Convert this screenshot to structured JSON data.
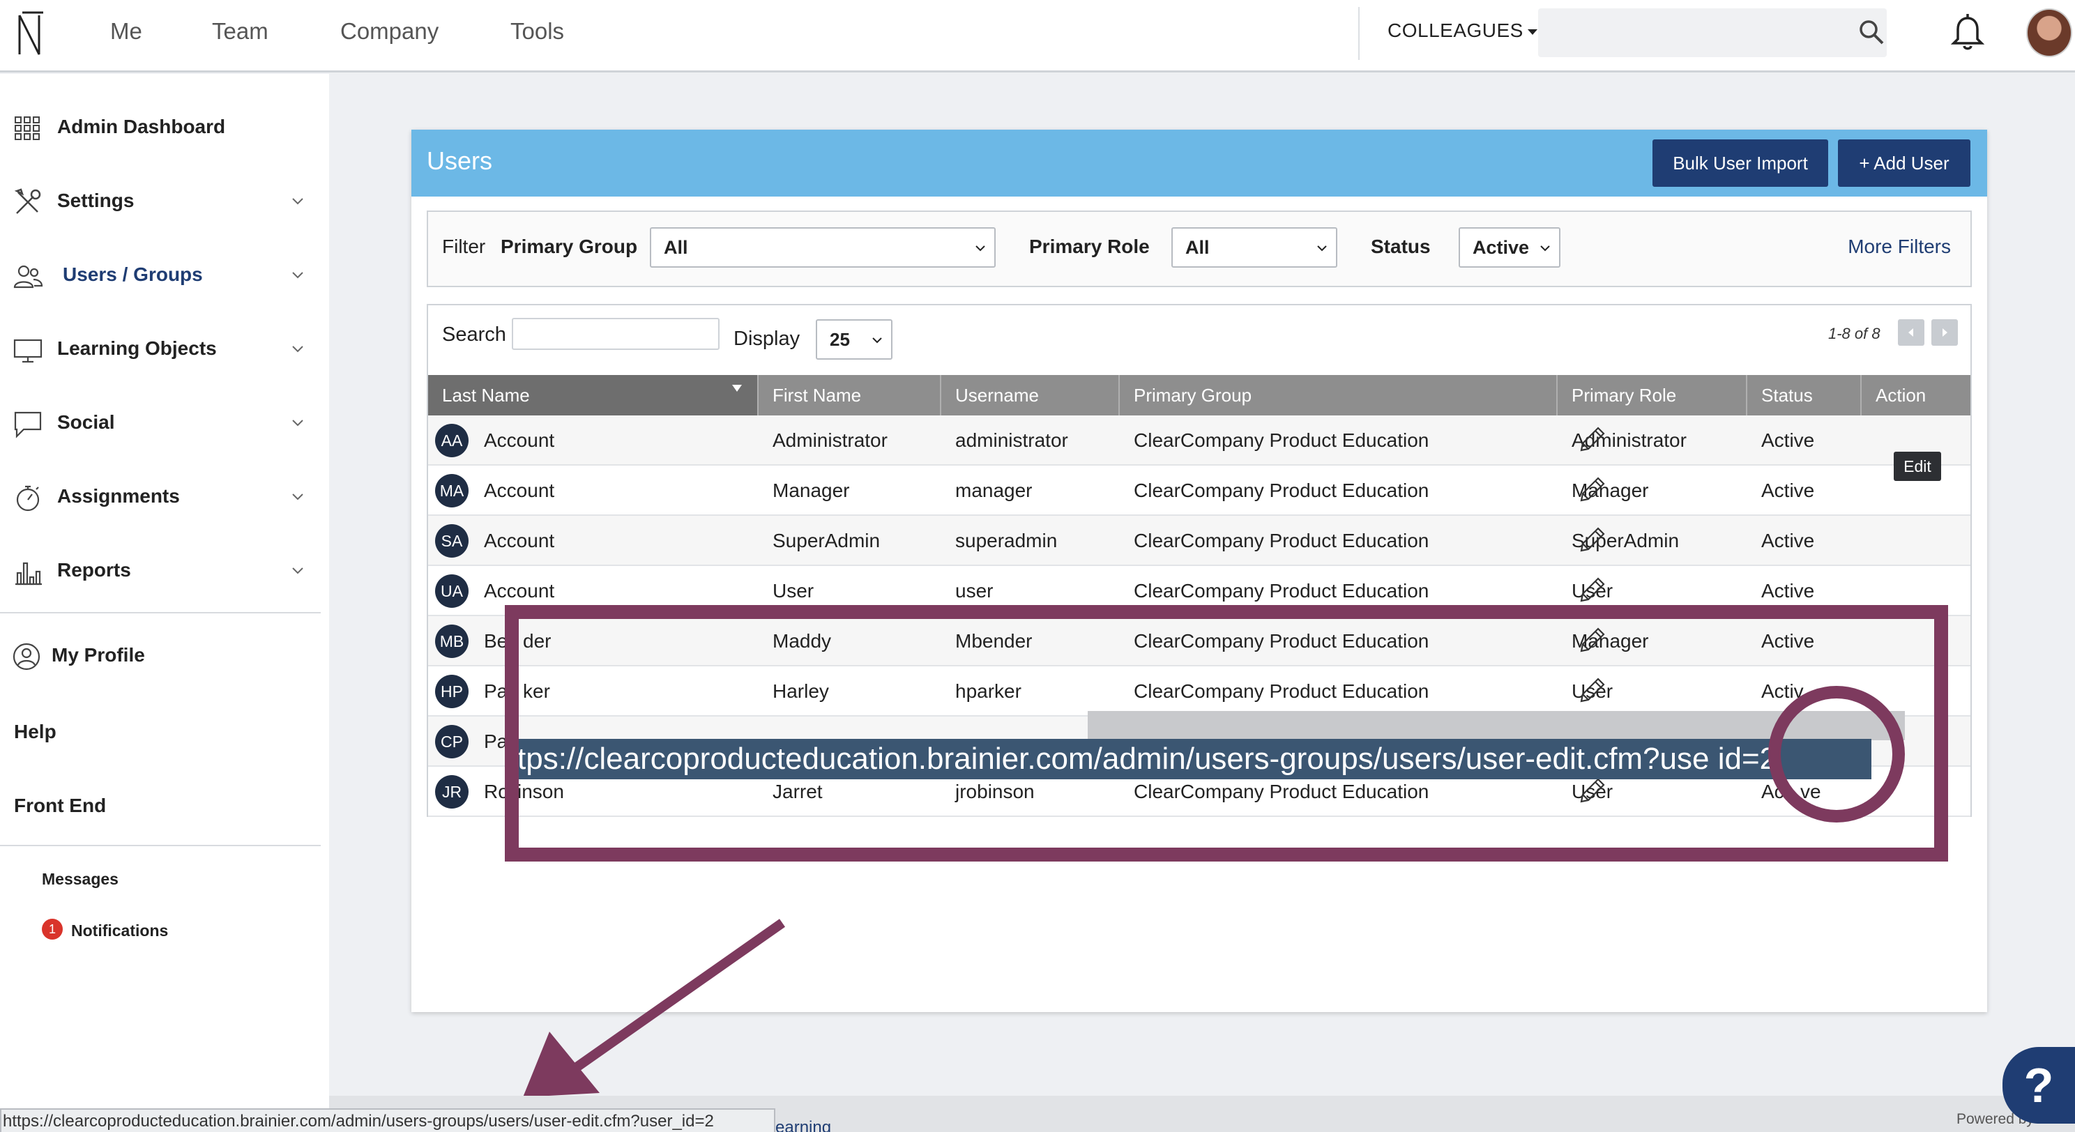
{
  "topnav": {
    "links": [
      "Me",
      "Team",
      "Company",
      "Tools"
    ],
    "colleagues_label": "COLLEAGUES",
    "search_placeholder": ""
  },
  "sidebar": {
    "items": [
      {
        "label": "Admin Dashboard",
        "icon": "grid-icon"
      },
      {
        "label": "Settings",
        "icon": "tools-icon"
      },
      {
        "label": "Users / Groups",
        "icon": "users-icon"
      },
      {
        "label": "Learning Objects",
        "icon": "monitor-icon"
      },
      {
        "label": "Social",
        "icon": "chat-icon"
      },
      {
        "label": "Assignments",
        "icon": "stopwatch-icon"
      },
      {
        "label": "Reports",
        "icon": "bar-chart-icon"
      }
    ],
    "my_profile": "My Profile",
    "help": "Help",
    "front_end": "Front End",
    "messages": "Messages",
    "notifications": "Notifications",
    "notifications_count": "1"
  },
  "card": {
    "title": "Users",
    "bulk_import": "Bulk User Import",
    "add_user": "+ Add User"
  },
  "filters": {
    "filter_label": "Filter",
    "primary_group_label": "Primary Group",
    "primary_group_value": "All",
    "primary_role_label": "Primary Role",
    "primary_role_value": "All",
    "status_label": "Status",
    "status_value": "Active",
    "more_filters": "More Filters"
  },
  "table": {
    "search_label": "Search",
    "display_label": "Display",
    "display_value": "25",
    "pager": "1-8 of 8",
    "columns": [
      "Last Name",
      "First Name",
      "Username",
      "Primary Group",
      "Primary Role",
      "Status",
      "Action"
    ],
    "rows": [
      {
        "initials": "AA",
        "last": "Account",
        "first": "Administrator",
        "username": "administrator",
        "group": "ClearCompany Product Education",
        "role": "Administrator",
        "status": "Active"
      },
      {
        "initials": "MA",
        "last": "Account",
        "first": "Manager",
        "username": "manager",
        "group": "ClearCompany Product Education",
        "role": "Manager",
        "status": "Active"
      },
      {
        "initials": "SA",
        "last": "Account",
        "first": "SuperAdmin",
        "username": "superadmin",
        "group": "ClearCompany Product Education",
        "role": "SuperAdmin",
        "status": "Active"
      },
      {
        "initials": "UA",
        "last": "Account",
        "first": "User",
        "username": "user",
        "group": "ClearCompany Product Education",
        "role": "User",
        "status": "Active"
      },
      {
        "initials": "MB",
        "last": "Be",
        "last_tail": "der",
        "first": "Maddy",
        "username": "Mbender",
        "group": "ClearCompany Product Education",
        "role": "Manager",
        "status": "Active"
      },
      {
        "initials": "HP",
        "last": "Pa",
        "last_tail": "ker",
        "first": "Harley",
        "username": "hparker",
        "group": "ClearCompany Product Education",
        "role": "User",
        "status": "Activ"
      },
      {
        "initials": "CP",
        "last": "Pa",
        "first": "",
        "username": "",
        "group": "",
        "role": "",
        "status": ""
      },
      {
        "initials": "JR",
        "last": "Ro",
        "last_tail": "inson",
        "first": "Jarret",
        "username": "jrobinson",
        "group": "ClearCompany Product Education",
        "role": "User",
        "status": "Ac",
        "status_tail": "ve"
      }
    ],
    "edit_tooltip": "Edit"
  },
  "annotation": {
    "url_zoom": "tps://clearcoproducteducation.brainier.com/admin/users-groups/users/user-edit.cfm?use   id=2",
    "color": "#7d3a5e"
  },
  "status_bar": {
    "url": "https://clearcoproducteducation.brainier.com/admin/users-groups/users/user-edit.cfm?user_id=2"
  },
  "footer": {
    "link_text": "earning",
    "powered": "Powered by"
  },
  "help_button": "?"
}
